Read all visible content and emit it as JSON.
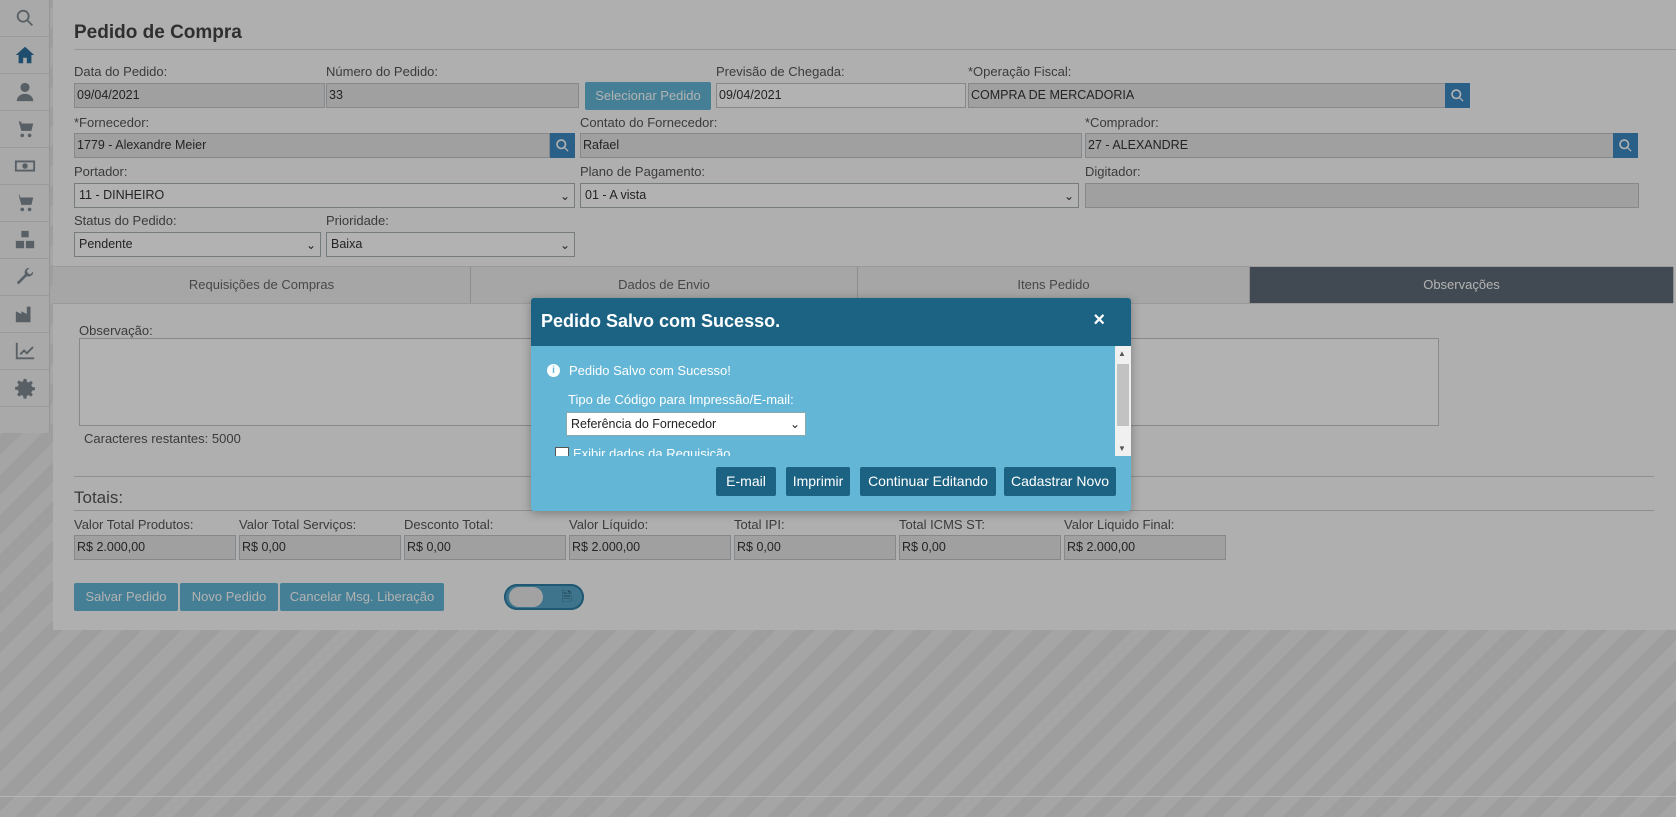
{
  "sidebar": {
    "icons": [
      "search-icon",
      "home-icon",
      "user-icon",
      "cart-add-icon",
      "money-icon",
      "cart-icon",
      "boxes-icon",
      "wrench-icon",
      "factory-icon",
      "chart-icon",
      "gear-icon"
    ]
  },
  "page": {
    "title": "Pedido de Compra"
  },
  "form": {
    "data_pedido": {
      "label": "Data do Pedido:",
      "value": "09/04/2021"
    },
    "numero_pedido": {
      "label": "Número do Pedido:",
      "value": "33"
    },
    "selecionar_pedido": "Selecionar Pedido",
    "previsao_chegada": {
      "label": "Previsão de Chegada:",
      "value": "09/04/2021"
    },
    "operacao_fiscal": {
      "label": "*Operação Fiscal:",
      "value": "COMPRA DE MERCADORIA"
    },
    "fornecedor": {
      "label": "*Fornecedor:",
      "value": "1779 - Alexandre Meier"
    },
    "contato_fornecedor": {
      "label": "Contato do Fornecedor:",
      "value": "Rafael"
    },
    "comprador": {
      "label": "*Comprador:",
      "value": "27 - ALEXANDRE"
    },
    "portador": {
      "label": "Portador:",
      "value": "11 - DINHEIRO"
    },
    "plano_pagamento": {
      "label": "Plano de Pagamento:",
      "value": "01 - A vista"
    },
    "digitador": {
      "label": "Digitador:",
      "value": ""
    },
    "status_pedido": {
      "label": "Status do Pedido:",
      "value": "Pendente"
    },
    "prioridade": {
      "label": "Prioridade:",
      "value": "Baixa"
    }
  },
  "tabs": [
    "Requisições de Compras",
    "Dados de Envio",
    "Itens Pedido",
    "Observações"
  ],
  "observacao": {
    "label": "Observação:",
    "caracteres": "Caracteres restantes: 5000"
  },
  "totais": {
    "title": "Totais:",
    "fields": [
      {
        "label": "Valor Total Produtos:",
        "value": "R$ 2.000,00"
      },
      {
        "label": "Valor Total Serviços:",
        "value": "R$ 0,00"
      },
      {
        "label": "Desconto Total:",
        "value": "R$ 0,00"
      },
      {
        "label": "Valor Líquido:",
        "value": "R$ 2.000,00"
      },
      {
        "label": "Total IPI:",
        "value": "R$ 0,00"
      },
      {
        "label": "Total ICMS ST:",
        "value": "R$ 0,00"
      },
      {
        "label": "Valor Liquido Final:",
        "value": "R$ 2.000,00"
      }
    ]
  },
  "actions": {
    "salvar": "Salvar Pedido",
    "novo": "Novo Pedido",
    "cancelar": "Cancelar Msg. Liberação"
  },
  "modal": {
    "title": "Pedido Salvo com Sucesso.",
    "close": "×",
    "message": "Pedido Salvo com Sucesso!",
    "tipo_label": "Tipo de Código para Impressão/E-mail:",
    "tipo_value": "Referência do Fornecedor",
    "checkbox_label": "Exibir dados da Requisição",
    "buttons": {
      "email": "E-mail",
      "imprimir": "Imprimir",
      "continuar": "Continuar Editando",
      "cadastrar": "Cadastrar Novo"
    }
  },
  "colors": {
    "accent": "#3d8ac2",
    "modal_header": "#1c6383",
    "modal_body": "#63b6d6",
    "active_tab": "#5e6b76"
  }
}
